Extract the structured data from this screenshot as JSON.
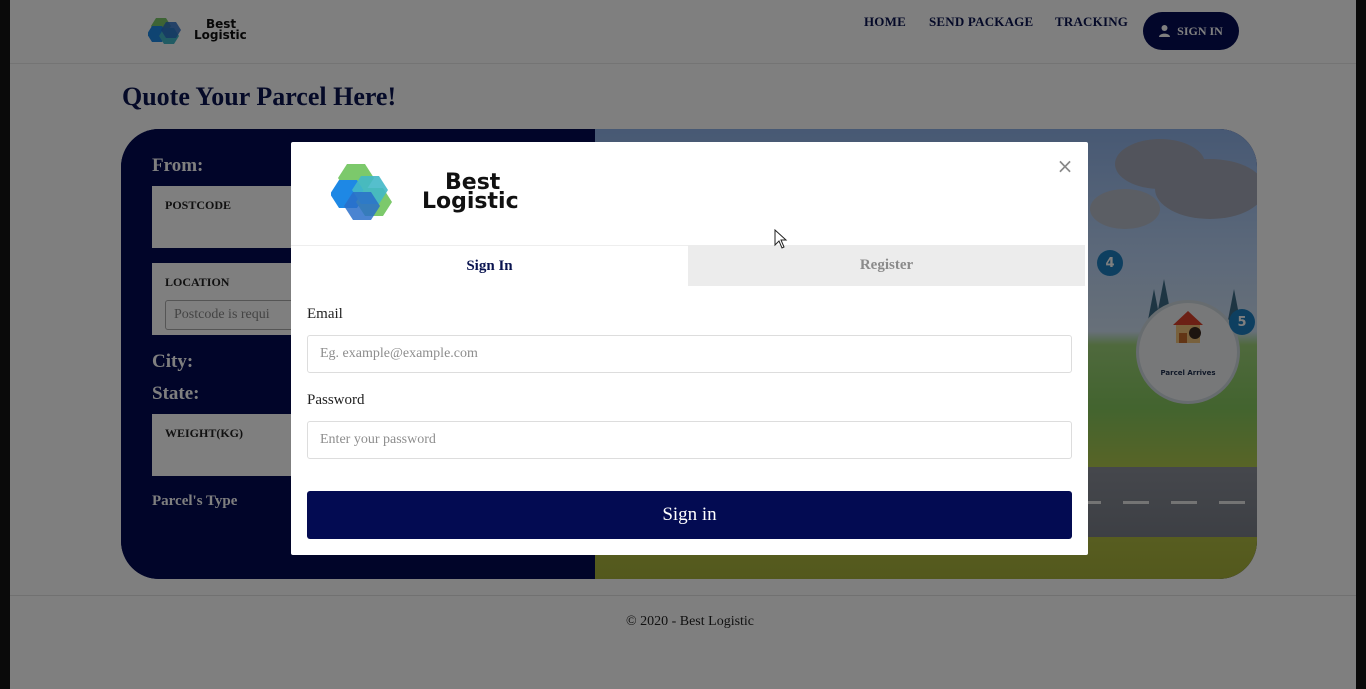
{
  "brand": {
    "name_line1": "Best",
    "name_line2": "Logistic"
  },
  "nav": {
    "links": [
      "HOME",
      "SEND PACKAGE",
      "TRACKING"
    ],
    "signin_label": "SIGN IN"
  },
  "page_title": "Quote Your Parcel Here!",
  "quote_form": {
    "from_label": "From:",
    "postcode_label": "POSTCODE",
    "location_label": "LOCATION",
    "location_placeholder": "Postcode is requi",
    "city_label": "City:",
    "state_label": "State:",
    "weight_label": "WEIGHT(KG)",
    "parcel_type_label": "Parcel's Type"
  },
  "illustration": {
    "step_badges": [
      "4",
      "5"
    ],
    "arrive_label": "Parcel Arrives"
  },
  "footer": {
    "text": "© 2020 - Best Logistic"
  },
  "modal": {
    "close_symbol": "×",
    "tabs": [
      {
        "label": "Sign In",
        "active": true
      },
      {
        "label": "Register",
        "active": false
      }
    ],
    "email_label": "Email",
    "email_placeholder": "Eg. example@example.com",
    "password_label": "Password",
    "password_placeholder": "Enter your password",
    "submit_label": "Sign in"
  },
  "colors": {
    "navy": "#030b52",
    "logo_blue": "#1e88e5",
    "logo_green": "#7cc96b",
    "logo_teal": "#43b8c8"
  }
}
